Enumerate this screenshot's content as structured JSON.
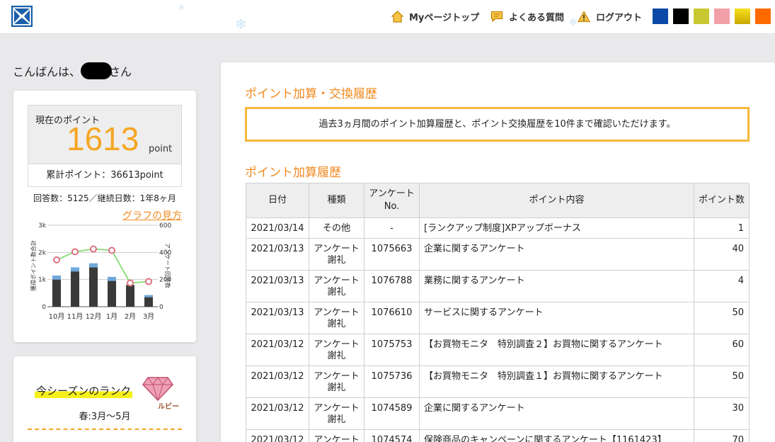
{
  "header": {
    "nav": [
      {
        "label": "Myページトップ",
        "icon": "house-icon"
      },
      {
        "label": "よくある質問",
        "icon": "speech-bubble-icon"
      },
      {
        "label": "ログアウト",
        "icon": "warning-icon"
      }
    ],
    "theme_colors": [
      "#0a4aa6",
      "#000000",
      "#c8c830",
      "#f2a0a8",
      "#e8cc10",
      "#ff6a00"
    ]
  },
  "greeting": {
    "prefix": "こんばんは、",
    "suffix": "さん"
  },
  "points": {
    "label": "現在のポイント",
    "value": "1613",
    "unit": "point",
    "cumulative": "累計ポイント：36613point",
    "answers": "回答数：5125／継続日数：1年8ヶ月",
    "graph_link": "グラフの見方"
  },
  "chart_data": {
    "type": "bar+line",
    "categories": [
      "10月",
      "11月",
      "12月",
      "1月",
      "2月",
      "3月"
    ],
    "y_left": {
      "label": "獲得ポイント数合計",
      "ticks": [
        "0",
        "1k",
        "2k",
        "3k"
      ],
      "ylim": [
        0,
        3000
      ]
    },
    "y_right": {
      "label": "アンケート回答数",
      "ticks": [
        "0",
        "200",
        "400",
        "600"
      ],
      "ylim": [
        0,
        600
      ]
    },
    "series": [
      {
        "kind": "bar-dark",
        "values": [
          1000,
          1300,
          1450,
          950,
          800,
          350
        ]
      },
      {
        "kind": "bar-light",
        "values": [
          150,
          150,
          150,
          150,
          0,
          80
        ]
      },
      {
        "kind": "line",
        "values": [
          345,
          405,
          425,
          415,
          175,
          185
        ]
      }
    ],
    "colors": {
      "bar_dark": "#3a3a3a",
      "bar_light": "#6fa8dc",
      "line": "#90e080",
      "marker": "#e07080"
    }
  },
  "rank": {
    "title": "今シーズンのランク",
    "badge": "ルビー",
    "season": "春:3月～5月"
  },
  "main": {
    "title": "ポイント加算・交換履歴",
    "notice": "過去3ヵ月間のポイント加算履歴と、ポイント交換履歴を10件まで確認いただけます。",
    "section_title": "ポイント加算履歴",
    "columns": [
      "日付",
      "種類",
      "アンケートNo.",
      "ポイント内容",
      "ポイント数"
    ],
    "rows": [
      {
        "date": "2021/03/14",
        "type": "その他",
        "no": "-",
        "content": "[ランクアップ制度]XPアップボーナス",
        "points": "1"
      },
      {
        "date": "2021/03/13",
        "type": "アンケート謝礼",
        "no": "1075663",
        "content": "企業に関するアンケート",
        "points": "40"
      },
      {
        "date": "2021/03/13",
        "type": "アンケート謝礼",
        "no": "1076788",
        "content": "業務に関するアンケート",
        "points": "4"
      },
      {
        "date": "2021/03/13",
        "type": "アンケート謝礼",
        "no": "1076610",
        "content": "サービスに関するアンケート",
        "points": "50"
      },
      {
        "date": "2021/03/12",
        "type": "アンケート謝礼",
        "no": "1075753",
        "content": "【お買物モニタ　特別調査２】お買物に関するアンケート",
        "points": "60"
      },
      {
        "date": "2021/03/12",
        "type": "アンケート謝礼",
        "no": "1075736",
        "content": "【お買物モニタ　特別調査１】お買物に関するアンケート",
        "points": "50"
      },
      {
        "date": "2021/03/12",
        "type": "アンケート謝礼",
        "no": "1074589",
        "content": "企業に関するアンケート",
        "points": "30"
      },
      {
        "date": "2021/03/12",
        "type": "アンケート",
        "no": "1074574",
        "content": "保険商品のキャンペーンに関するアンケート【1161423】",
        "points": "70"
      }
    ]
  }
}
